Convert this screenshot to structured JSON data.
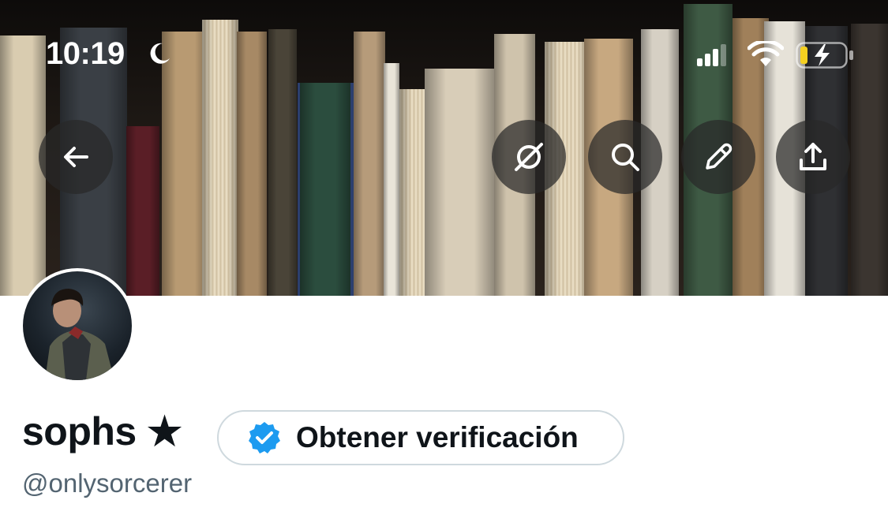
{
  "status_bar": {
    "time": "10:19",
    "focus_mode_icon": "moon-icon",
    "icons": [
      "cellular-signal-icon",
      "wifi-icon",
      "battery-charging-icon"
    ]
  },
  "banner": {
    "description_icon": "bookshelf-banner-image"
  },
  "header_actions": [
    {
      "name": "back-button",
      "icon": "arrow-left-icon"
    },
    {
      "name": "grok-button",
      "icon": "grok-icon"
    },
    {
      "name": "search-button",
      "icon": "search-icon"
    },
    {
      "name": "edit-button",
      "icon": "pencil-icon"
    },
    {
      "name": "share-button",
      "icon": "share-icon"
    }
  ],
  "profile": {
    "display_name": "sophs ★",
    "handle": "@onlysorcerer",
    "verify_button_label": "Obtener verificación",
    "verify_badge_color": "#1d9bf0"
  },
  "colors": {
    "text_primary": "#0f1419",
    "text_secondary": "#536471",
    "button_border": "#cfd9de",
    "accent": "#1d9bf0"
  }
}
